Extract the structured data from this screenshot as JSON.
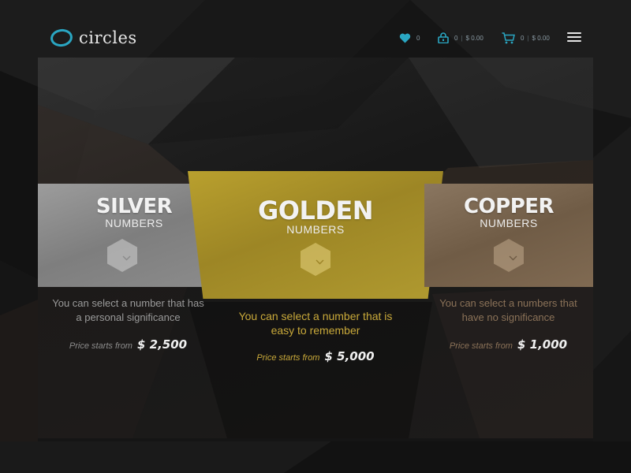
{
  "header": {
    "logo_text": "circles",
    "wishlist": {
      "icon": "heart-icon",
      "count": "0"
    },
    "lock": {
      "icon": "lock-icon",
      "count": "0",
      "amount": "$ 0.00"
    },
    "cart": {
      "icon": "cart-icon",
      "count": "0",
      "amount": "$ 0.00"
    },
    "menu_icon": "hamburger-menu-icon"
  },
  "plans": {
    "silver": {
      "title": "SILVER",
      "subtitle": "NUMBERS",
      "description_line1": "You can select a number that has",
      "description_line2": "a personal significance",
      "price_label": "Price starts from",
      "price": "$ 2,500"
    },
    "golden": {
      "title": "GOLDEN",
      "subtitle": "NUMBERS",
      "description_line1": "You can select a number that is",
      "description_line2": "easy to remember",
      "price_label": "Price starts from",
      "price": "$ 5,000"
    },
    "copper": {
      "title": "COPPER",
      "subtitle": "NUMBERS",
      "description_line1": "You can select a numbers that",
      "description_line2": "have no significance",
      "price_label": "Price starts from",
      "price": "$ 1,000"
    }
  },
  "colors": {
    "accent": "#2aa6c2",
    "gold_text": "#c9a93a",
    "silver_text": "#9a9a9a",
    "copper_text": "#8b7258"
  }
}
